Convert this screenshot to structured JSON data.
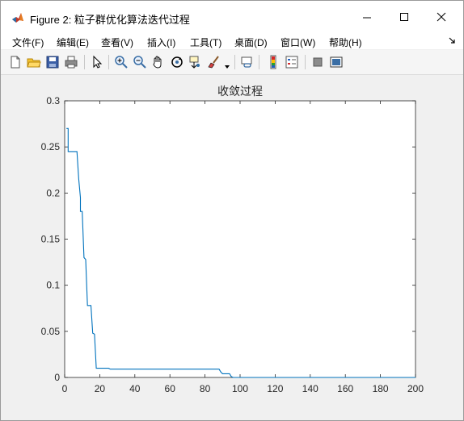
{
  "window": {
    "title": "Figure 2: 粒子群优化算法迭代过程",
    "controls": [
      "minimize",
      "maximize",
      "close"
    ]
  },
  "menu": [
    "文件(F)",
    "编辑(E)",
    "查看(V)",
    "插入(I)",
    "工具(T)",
    "桌面(D)",
    "窗口(W)",
    "帮助(H)"
  ],
  "toolbar": [
    "new-figure-icon",
    "open-file-icon",
    "save-icon",
    "print-icon",
    "pointer-icon",
    "zoom-in-icon",
    "zoom-out-icon",
    "pan-hand-icon",
    "rotate-3d-icon",
    "data-cursor-icon",
    "brush-icon",
    "brush-dropdown-icon",
    "link-plot-icon",
    "colorbar-icon",
    "legend-icon",
    "hide-plot-tools-icon",
    "show-plot-tools-icon"
  ],
  "colors": {
    "line": "#0072bd"
  },
  "chart_data": {
    "type": "line",
    "title": "收敛过程",
    "xlabel": "",
    "ylabel": "",
    "xlim": [
      0,
      200
    ],
    "ylim": [
      0,
      0.3
    ],
    "xticks": [
      "0",
      "20",
      "40",
      "60",
      "80",
      "100",
      "120",
      "140",
      "160",
      "180",
      "200"
    ],
    "yticks": [
      "0",
      "0.05",
      "0.1",
      "0.15",
      "0.2",
      "0.25",
      "0.3"
    ],
    "grid": false,
    "series": [
      {
        "points": [
          [
            1,
            0.27
          ],
          [
            2,
            0.27
          ],
          [
            2,
            0.245
          ],
          [
            3,
            0.245
          ],
          [
            4,
            0.245
          ],
          [
            5,
            0.245
          ],
          [
            6,
            0.245
          ],
          [
            7,
            0.245
          ],
          [
            8,
            0.215
          ],
          [
            9,
            0.195
          ],
          [
            9,
            0.18
          ],
          [
            10,
            0.18
          ],
          [
            11,
            0.13
          ],
          [
            12,
            0.128
          ],
          [
            13,
            0.078
          ],
          [
            15,
            0.078
          ],
          [
            16,
            0.048
          ],
          [
            17,
            0.047
          ],
          [
            18,
            0.01
          ],
          [
            25,
            0.01
          ],
          [
            26,
            0.009
          ],
          [
            88,
            0.009
          ],
          [
            89,
            0.006
          ],
          [
            90,
            0.004
          ],
          [
            94,
            0.004
          ],
          [
            95,
            0.001
          ],
          [
            96,
            0
          ],
          [
            200,
            0
          ]
        ]
      }
    ]
  }
}
